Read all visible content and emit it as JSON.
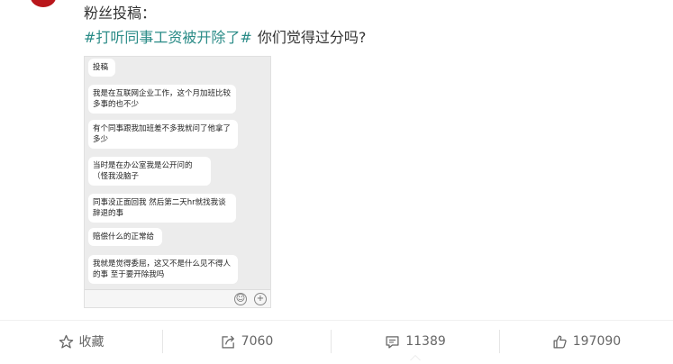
{
  "post": {
    "intro": "粉丝投稿：",
    "topic_tag": "#打听同事工资被开除了#",
    "question": "你们觉得过分吗?"
  },
  "chat_image": {
    "messages": [
      "投稿",
      "我是在互联网企业工作，这个月加班比较多事的也不少",
      "有个同事跟我加班差不多我就问了他拿了多少",
      "当时是在办公室我是公开问的（怪我没脑子",
      "同事没正面回我 然后第二天hr就找我谈辞退的事",
      "赔偿什么的正常给",
      "我就是觉得委屈，这又不是什么见不得人的事 至于要开除我吗"
    ]
  },
  "actions": {
    "favorite_label": "收藏",
    "repost_count": "7060",
    "comment_count": "11389",
    "like_count": "197090"
  },
  "icons": {
    "favorite": "star-icon",
    "repost": "share-arrow-icon",
    "comment": "comment-bubble-icon",
    "like": "thumbs-up-icon",
    "emoji": "emoji-icon",
    "plus": "plus-icon"
  }
}
